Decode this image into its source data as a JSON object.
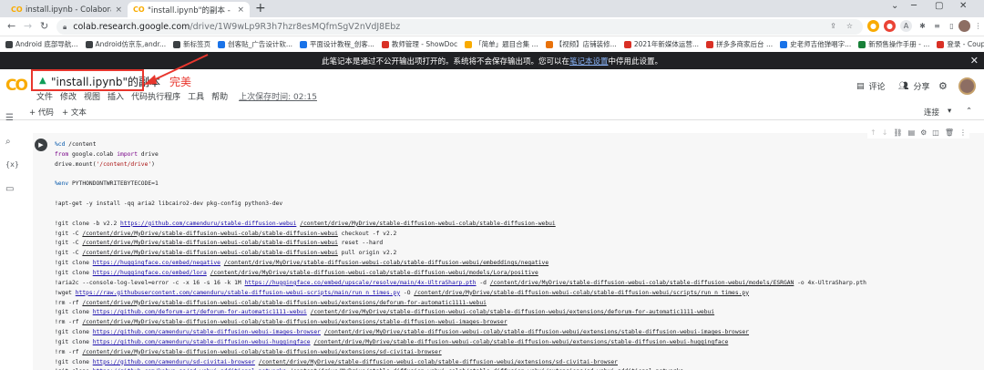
{
  "browser": {
    "tabs": [
      {
        "title": "install.ipynb - Colaboratory",
        "close": "×"
      },
      {
        "title": "\"install.ipynb\"的副本 - Colab",
        "close": "×"
      }
    ],
    "new_tab": "+",
    "window_controls": [
      "⌄",
      "─",
      "▢",
      "✕"
    ],
    "url_host": "colab.research.google.com",
    "url_path": "/drive/1W9wLp9R3h7hzr8esMQfmSgV2nVdJ8Ebz",
    "nav": {
      "back": "←",
      "forward": "→",
      "reload": "↻"
    }
  },
  "bookmarks": [
    {
      "label": "Android 底部导航...",
      "color": "#3c4043"
    },
    {
      "label": "Android仿京东,andr...",
      "color": "#3c4043"
    },
    {
      "label": "新标签页",
      "color": "#3c4043"
    },
    {
      "label": "创客贴_广告设计软...",
      "color": "#1a73e8"
    },
    {
      "label": "平面设计教程_创客...",
      "color": "#1a73e8"
    },
    {
      "label": "教师管理 - ShowDoc",
      "color": "#d93025"
    },
    {
      "label": "「简单」题目合集 ...",
      "color": "#f9ab00"
    },
    {
      "label": "【视频】店铺装修...",
      "color": "#e8710a"
    },
    {
      "label": "2021年新媒体运营...",
      "color": "#d93025"
    },
    {
      "label": "拼多多商家后台 ...",
      "color": "#d93025"
    },
    {
      "label": "史老师吉他弹唱字...",
      "color": "#1a73e8"
    },
    {
      "label": "新预售操作手册 - ...",
      "color": "#188038"
    },
    {
      "label": "登录 - Coupang...",
      "color": "#d93025"
    }
  ],
  "notice": {
    "text_before": "此笔记本是通过不公开输出项打开的。系统将不会保存输出项。您可以在",
    "link": "笔记本设置",
    "text_after": "中停用此设置。",
    "close": "✕"
  },
  "colab": {
    "logo": "CO",
    "title": "\"install.ipynb\"的副本",
    "annotation": "完美",
    "menu": [
      "文件",
      "修改",
      "视图",
      "插入",
      "代码执行程序",
      "工具",
      "帮助"
    ],
    "saved": "上次保存时间: 02:15",
    "comment": "评论",
    "share": "分享"
  },
  "toolbar": {
    "add_code": "+ 代码",
    "add_text": "+ 文本",
    "connect": "连接"
  },
  "cell": {
    "run": "▶",
    "lines": [
      "%cd /content",
      "from google.colab import drive",
      "drive.mount('/content/drive')",
      "",
      "%env PYTHONDONTWRITEBYTECODE=1",
      "",
      "!apt-get -y install -qq aria2 libcairo2-dev pkg-config python3-dev",
      "",
      "!git clone -b v2.2 https://github.com/camenduru/stable-diffusion-webui /content/drive/MyDrive/stable-diffusion-webui-colab/stable-diffusion-webui",
      "!git -C /content/drive/MyDrive/stable-diffusion-webui-colab/stable-diffusion-webui checkout -f v2.2",
      "!git -C /content/drive/MyDrive/stable-diffusion-webui-colab/stable-diffusion-webui reset --hard",
      "!git -C /content/drive/MyDrive/stable-diffusion-webui-colab/stable-diffusion-webui pull origin v2.2",
      "!git clone https://huggingface.co/embed/negative /content/drive/MyDrive/stable-diffusion-webui-colab/stable-diffusion-webui/embeddings/negative",
      "!git clone https://huggingface.co/embed/lora /content/drive/MyDrive/stable-diffusion-webui-colab/stable-diffusion-webui/models/Lora/positive",
      "!aria2c --console-log-level=error -c -x 16 -s 16 -k 1M https://huggingface.co/embed/upscale/resolve/main/4x-UltraSharp.pth -d /content/drive/MyDrive/stable-diffusion-webui-colab/stable-diffusion-webui/models/ESRGAN -o 4x-UltraSharp.pth",
      "!wget https://raw.githubusercontent.com/camenduru/stable-diffusion-webui-scripts/main/run_n_times.py -O /content/drive/MyDrive/stable-diffusion-webui-colab/stable-diffusion-webui/scripts/run_n_times.py",
      "!rm -rf /content/drive/MyDrive/stable-diffusion-webui-colab/stable-diffusion-webui/extensions/deforum-for-automatic1111-webui",
      "!git clone https://github.com/deforum-art/deforum-for-automatic1111-webui /content/drive/MyDrive/stable-diffusion-webui-colab/stable-diffusion-webui/extensions/deforum-for-automatic1111-webui",
      "!rm -rf /content/drive/MyDrive/stable-diffusion-webui-colab/stable-diffusion-webui/extensions/stable-diffusion-webui-images-browser",
      "!git clone https://github.com/camenduru/stable-diffusion-webui-images-browser /content/drive/MyDrive/stable-diffusion-webui-colab/stable-diffusion-webui/extensions/stable-diffusion-webui-images-browser",
      "!git clone https://github.com/camenduru/stable-diffusion-webui-huggingface /content/drive/MyDrive/stable-diffusion-webui-colab/stable-diffusion-webui/extensions/stable-diffusion-webui-huggingface",
      "!rm -rf /content/drive/MyDrive/stable-diffusion-webui-colab/stable-diffusion-webui/extensions/sd-civitai-browser",
      "!git clone https://github.com/camenduru/sd-civitai-browser /content/drive/MyDrive/stable-diffusion-webui-colab/stable-diffusion-webui/extensions/sd-civitai-browser",
      "!git clone https://github.com/kohya-ss/sd-webui-additional-networks /content/drive/MyDrive/stable-diffusion-webui-colab/stable-diffusion-webui/extensions/sd-webui-additional-networks"
    ]
  },
  "colors": {
    "accent_red": "#e8362d",
    "colab_orange": "#f9ab00",
    "notice_bg": "#202124"
  }
}
